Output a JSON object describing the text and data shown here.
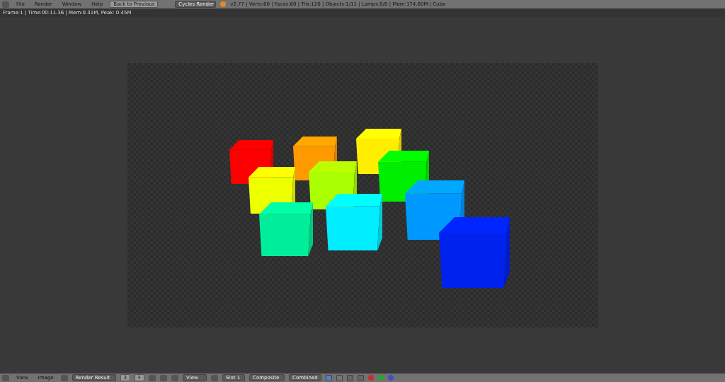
{
  "top_bar": {
    "menus": [
      "File",
      "Render",
      "Window",
      "Help"
    ],
    "back_button": "Back to Previous",
    "engine": "Cycles Render",
    "stats": "v2.77 | Verts:80 | Faces:60 | Tris:120 | Objects:1/11 | Lamps:0/0 | Mem:174.60M | Cube"
  },
  "render_info": "Frame:1 | Time:00:11.36 | Mem:0.31M, Peak: 0.45M",
  "bottom_bar": {
    "menus": [
      "View",
      "Image"
    ],
    "image_name": "Render Result",
    "users": "3",
    "fake_user": "F",
    "view": "View",
    "slot": "Slot 1",
    "layer": "Composite",
    "pass": "Combined",
    "display_modes": [
      {
        "selected": true
      },
      {
        "selected": false
      },
      {
        "selected": false
      },
      {
        "selected": false
      }
    ]
  }
}
